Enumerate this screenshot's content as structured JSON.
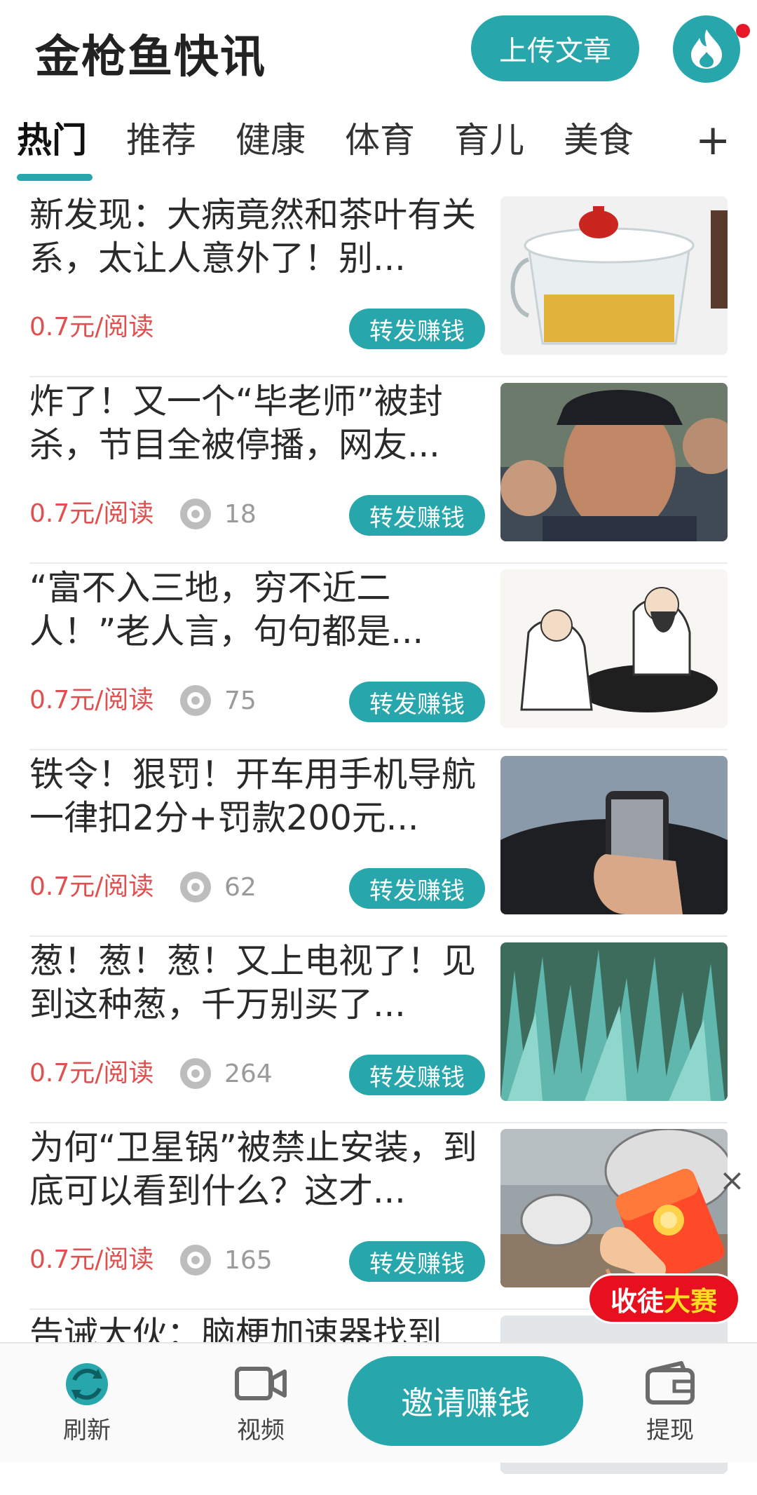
{
  "header": {
    "title": "金枪鱼快讯",
    "upload_label": "上传文章",
    "avatar_icon": "flame-icon"
  },
  "tabs": {
    "items": [
      "热门",
      "推荐",
      "健康",
      "体育",
      "育儿",
      "美食"
    ],
    "active": "热门",
    "more": "+"
  },
  "feed": {
    "items": [
      {
        "title": "新发现：大病竟然和茶叶有关系，太让人意外了！别...",
        "price": "0.7元/阅读",
        "views": "",
        "share": "转发赚钱",
        "thumb": "teapot-glass"
      },
      {
        "title": "炸了！又一个“毕老师”被封杀，节目全被停播，网友...",
        "price": "0.7元/阅读",
        "views": "18",
        "share": "转发赚钱",
        "thumb": "man-in-cap"
      },
      {
        "title": "“富不入三地，穷不近二人！”老人言，句句都是...",
        "price": "0.7元/阅读",
        "views": "75",
        "share": "转发赚钱",
        "thumb": "ink-painting"
      },
      {
        "title": "铁令！狠罚！开车用手机导航一律扣2分+罚款200元...",
        "price": "0.7元/阅读",
        "views": "62",
        "share": "转发赚钱",
        "thumb": "phone-in-car"
      },
      {
        "title": "葱！葱！葱！又上电视了！见到这种葱，千万别买了...",
        "price": "0.7元/阅读",
        "views": "264",
        "share": "转发赚钱",
        "thumb": "green-onions"
      },
      {
        "title": "为何“卫星锅”被禁止安装，到底可以看到什么？这才...",
        "price": "0.7元/阅读",
        "views": "165",
        "share": "转发赚钱",
        "thumb": "satellite-dish"
      },
      {
        "title": "告诫大伙：脑梗加速器找到",
        "price": "",
        "views": "",
        "share": "",
        "thumb": "partial"
      }
    ]
  },
  "promo": {
    "label_part1": "收徒",
    "label_part2": "大赛",
    "close": "×"
  },
  "bottom_nav": {
    "refresh": "刷新",
    "video": "视频",
    "invite": "邀请赚钱",
    "withdraw": "提现"
  },
  "colors": {
    "accent": "#27a6ac",
    "price": "#e05050",
    "badge": "#e5192a"
  }
}
